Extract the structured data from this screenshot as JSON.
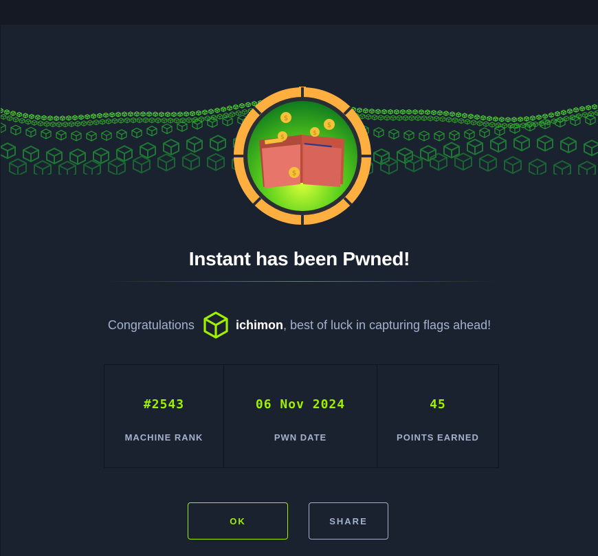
{
  "modal": {
    "title": "Instant has been Pwned!",
    "congrats_prefix": "Congratulations",
    "username": "ichimon",
    "congrats_suffix": ", best of luck in capturing flags ahead!",
    "badge_icon": "wallet-icon",
    "avatar_icon": "hexagon-cube-icon"
  },
  "stats": [
    {
      "value": "#2543",
      "label": "MACHINE RANK"
    },
    {
      "value": "06 Nov 2024",
      "label": "PWN DATE"
    },
    {
      "value": "45",
      "label": "POINTS EARNED"
    }
  ],
  "buttons": {
    "ok": "OK",
    "share": "SHARE"
  },
  "colors": {
    "accent": "#9fef00",
    "background": "#1a2230",
    "text_muted": "#a4b1cd",
    "badge_ring": "#ffaf40"
  }
}
